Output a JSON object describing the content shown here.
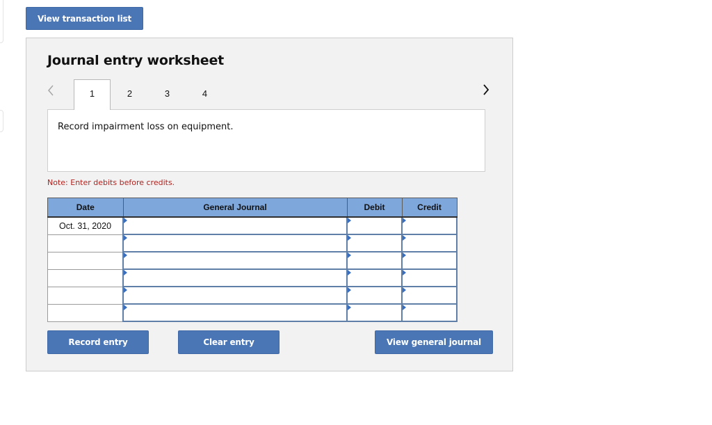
{
  "header": {
    "view_transaction_list_label": "View transaction list"
  },
  "worksheet": {
    "title": "Journal entry worksheet",
    "prev_icon": "chevron-left-icon",
    "next_icon": "chevron-right-icon",
    "tabs": [
      {
        "label": "1",
        "active": true
      },
      {
        "label": "2",
        "active": false
      },
      {
        "label": "3",
        "active": false
      },
      {
        "label": "4",
        "active": false
      }
    ],
    "description": "Record impairment loss on equipment.",
    "note": "Note: Enter debits before credits."
  },
  "journal": {
    "columns": [
      "Date",
      "General Journal",
      "Debit",
      "Credit"
    ],
    "rows": [
      {
        "date": "Oct. 31, 2020",
        "account": "",
        "debit": "",
        "credit": ""
      },
      {
        "date": "",
        "account": "",
        "debit": "",
        "credit": ""
      },
      {
        "date": "",
        "account": "",
        "debit": "",
        "credit": ""
      },
      {
        "date": "",
        "account": "",
        "debit": "",
        "credit": ""
      },
      {
        "date": "",
        "account": "",
        "debit": "",
        "credit": ""
      },
      {
        "date": "",
        "account": "",
        "debit": "",
        "credit": ""
      }
    ]
  },
  "actions": {
    "record_entry_label": "Record entry",
    "clear_entry_label": "Clear entry",
    "view_general_journal_label": "View general journal"
  },
  "colors": {
    "button": "#4a76b5",
    "header_fill": "#7ea7db",
    "note": "#b0231f",
    "panel": "#f2f2f2"
  }
}
